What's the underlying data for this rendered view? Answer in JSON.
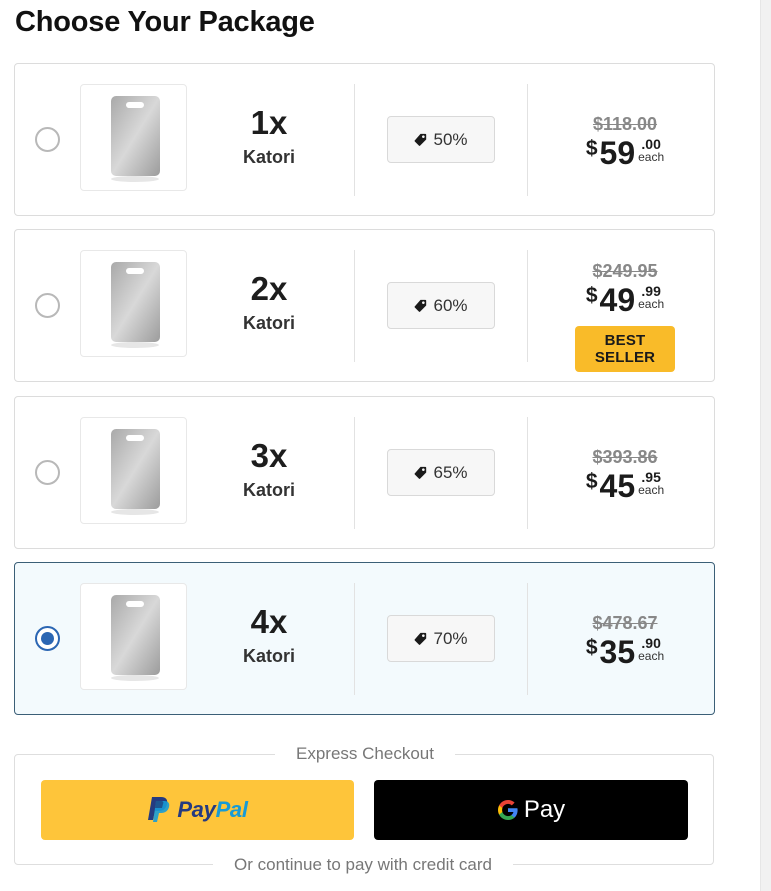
{
  "title": "Choose Your Package",
  "packages": [
    {
      "quantity": "1x",
      "name": "Katori",
      "discount": "50%",
      "old_price": "$118.00",
      "currency": "$",
      "whole": "59",
      "cents": ".00",
      "each": "each",
      "badge": "",
      "selected": false
    },
    {
      "quantity": "2x",
      "name": "Katori",
      "discount": "60%",
      "old_price": "$249.95",
      "currency": "$",
      "whole": "49",
      "cents": ".99",
      "each": "each",
      "badge": "BEST SELLER",
      "selected": false
    },
    {
      "quantity": "3x",
      "name": "Katori",
      "discount": "65%",
      "old_price": "$393.86",
      "currency": "$",
      "whole": "45",
      "cents": ".95",
      "each": "each",
      "badge": "",
      "selected": false
    },
    {
      "quantity": "4x",
      "name": "Katori",
      "discount": "70%",
      "old_price": "$478.67",
      "currency": "$",
      "whole": "35",
      "cents": ".90",
      "each": "each",
      "badge": "",
      "selected": true
    }
  ],
  "checkout": {
    "express_label": "Express Checkout",
    "paypal_label": {
      "part1": "Pay",
      "part2": "Pal"
    },
    "gpay_label": "Pay",
    "card_label": "Or continue to pay with credit card"
  },
  "icons": {
    "discount": "tag-icon",
    "radio": "radio-button",
    "paypal": "paypal-logo-icon",
    "google": "google-g-icon"
  },
  "colors": {
    "accent_selected": "#2b66b3",
    "selected_bg": "#f3fafd",
    "badge": "#f9bb29",
    "paypal_button": "#fec53a",
    "gpay_button": "#000000"
  }
}
